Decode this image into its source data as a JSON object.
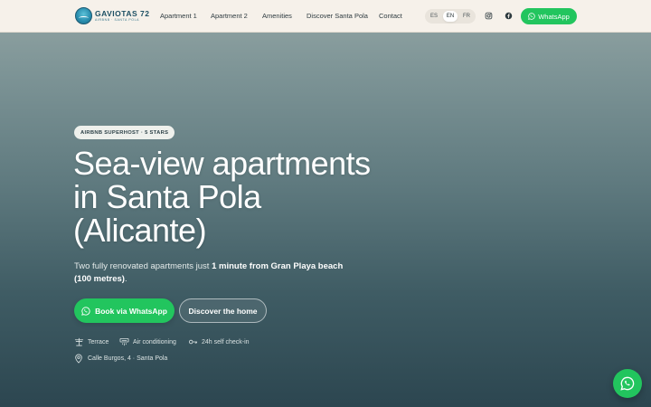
{
  "brand": {
    "title": "GAVIOTAS 72",
    "subtitle": "AIRBNB · SANTA POLA"
  },
  "nav": {
    "items": [
      {
        "label": "Apartment 1"
      },
      {
        "label": "Apartment 2"
      },
      {
        "label": "Amenities"
      },
      {
        "label": "Discover Santa Pola"
      },
      {
        "label": "Contact"
      }
    ]
  },
  "languages": {
    "options": [
      "ES",
      "EN",
      "FR"
    ],
    "selected": "EN"
  },
  "header_cta": {
    "label": "WhatsApp"
  },
  "hero": {
    "badge": "AIRBNB SUPERHOST · 5 STARS",
    "title": "Sea-view apartments in Santa Pola (Alicante)",
    "subtitle_pre": "Two fully renovated apartments just ",
    "subtitle_bold": "1 minute from Gran Playa beach (100 metres)",
    "subtitle_post": ".",
    "cta_primary": "Book via WhatsApp",
    "cta_secondary": "Discover the home",
    "features": [
      {
        "icon": "terrace-icon",
        "label": "Terrace"
      },
      {
        "icon": "air-conditioning-icon",
        "label": "Air conditioning"
      },
      {
        "icon": "key-icon",
        "label": "24h self check-in"
      }
    ],
    "address": "Calle Burgos, 4 · Santa Pola"
  },
  "colors": {
    "accent": "#22c55e",
    "header_bg": "#f6f1ea",
    "hero_top": "#93a5a4",
    "hero_bottom": "#2c4650"
  }
}
